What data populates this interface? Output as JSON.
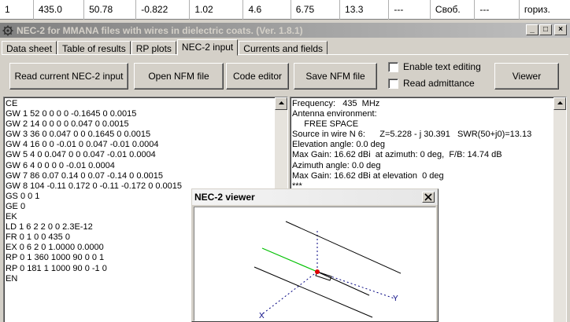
{
  "top_table": {
    "cells": [
      "1",
      "435.0",
      "50.78",
      "-0.822",
      "1.02",
      "4.6",
      "6.75",
      "13.3",
      "---",
      "Своб.",
      "---",
      "гориз."
    ]
  },
  "window": {
    "title": "NEC-2 for MMANA files with wires in dielectric coats. (Ver. 1.8.1)",
    "minimize": "_",
    "maximize": "□",
    "close": "×"
  },
  "tabs": [
    "Data sheet",
    "Table of results",
    "RP plots",
    "NEC-2 input",
    "Currents and fields"
  ],
  "active_tab": "NEC-2 input",
  "buttons": {
    "read": "Read current NEC-2 input",
    "open": "Open NFM file",
    "code": "Code editor",
    "save": "Save NFM file",
    "viewer": "Viewer"
  },
  "checkboxes": {
    "enable_text_editing": {
      "label": "Enable text editing",
      "checked": false
    },
    "read_admittance": {
      "label": "Read admittance",
      "checked": false
    }
  },
  "nec_input_lines": [
    "CE",
    "GW 1 52 0 0 0 0 -0.1645 0 0.0015",
    "GW 2 14 0 0 0 0 0.047 0 0.0015",
    "GW 3 36 0 0.047 0 0 0.1645 0 0.0015",
    "GW 4 16 0 0 -0.01 0 0.047 -0.01 0.0004",
    "GW 5 4 0 0.047 0 0 0.047 -0.01 0.0004",
    "GW 6 4 0 0 0 0 -0.01 0.0004",
    "GW 7 86 0.07 0.14 0 0.07 -0.14 0 0.0015",
    "GW 8 104 -0.11 0.172 0 -0.11 -0.172 0 0.0015",
    "GS 0 0 1",
    "GE 0",
    "EK",
    "LD 1 6 2 2 0 0 2.3E-12",
    "FR 0 1 0 0 435 0",
    "EX 0 6 2 0 1.0000 0.0000",
    "RP 0 1 360 1000 90 0 0 1",
    "RP 0 181 1 1000 90 0 -1 0",
    "EN"
  ],
  "results_lines": [
    "Frequency:   435  MHz",
    "Antenna environment:",
    "     FREE SPACE",
    "Source in wire N 6:      Z=5.228 - j 30.391   SWR(50+j0)=13.13",
    "Elevation angle: 0.0 deg",
    "Max Gain: 16.62 dBi  at azimuth: 0 deg,  F/B: 14.74 dB",
    "Azimuth angle: 0.0 deg",
    "Max Gain: 16.62 dBi at elevation  0 deg",
    "***"
  ],
  "viewer": {
    "title": "NEC-2 viewer",
    "axis_y_label": "Y",
    "axis_x_label": "X",
    "colors": {
      "driven_element": "#00c000",
      "feed_point": "#e00000",
      "wires": "#000000",
      "axes": "#0000a0"
    }
  }
}
